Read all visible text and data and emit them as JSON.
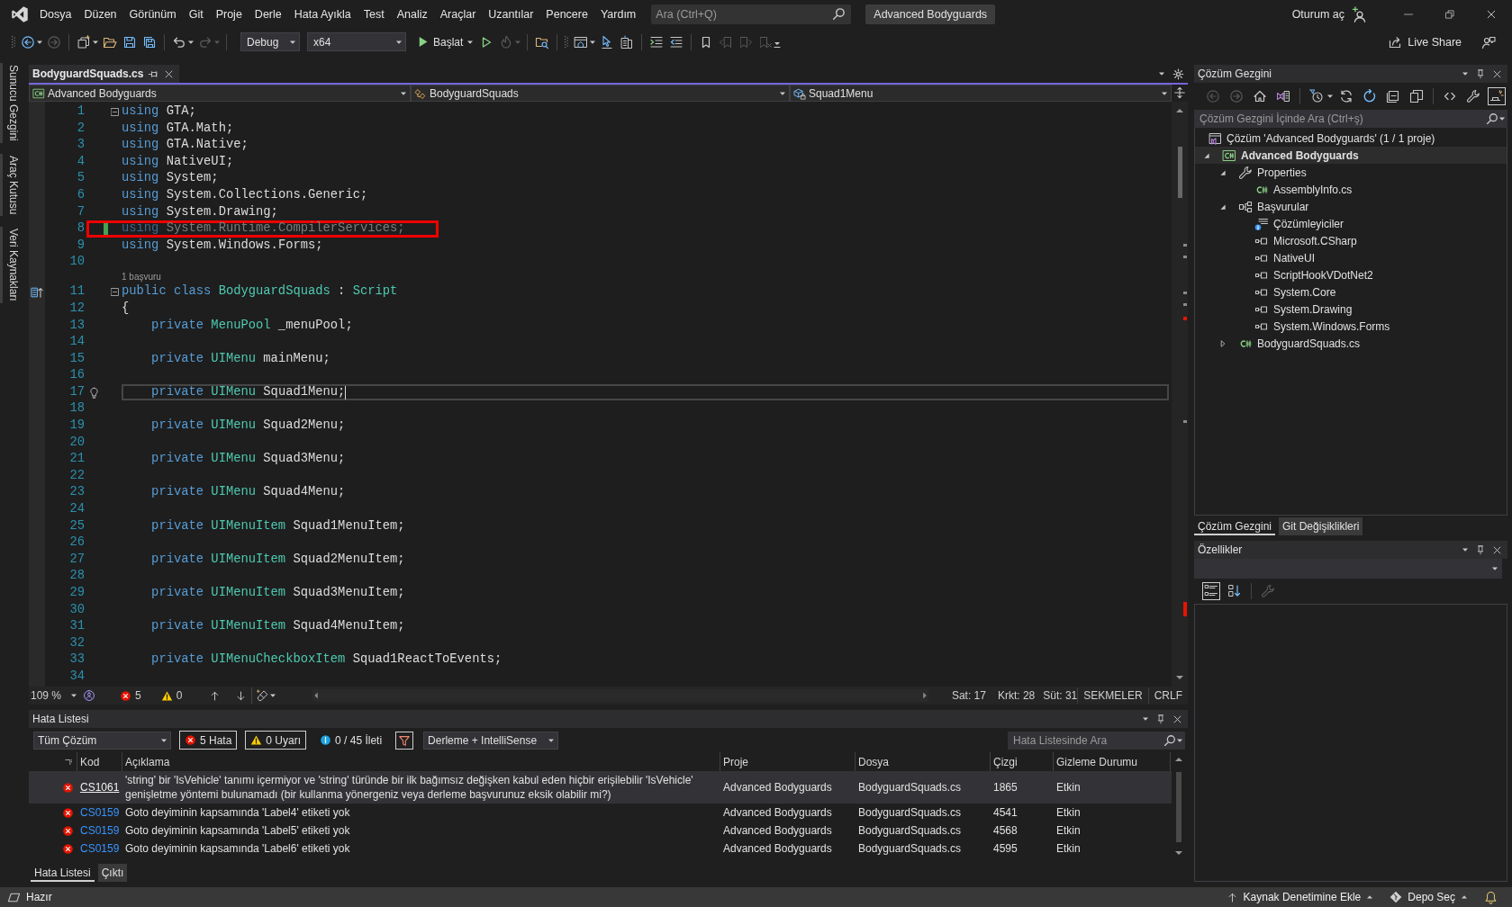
{
  "title_bar": {
    "menu": [
      "Dosya",
      "Düzen",
      "Görünüm",
      "Git",
      "Proje",
      "Derle",
      "Hata Ayıkla",
      "Test",
      "Analiz",
      "Araçlar",
      "Uzantılar",
      "Pencere",
      "Yardım"
    ],
    "search": {
      "placeholder": "Ara (Ctrl+Q)"
    },
    "solution_name": "Advanced Bodyguards",
    "sign_in": "Oturum aç"
  },
  "toolbar": {
    "history": [
      {
        "disabled": false
      },
      {
        "disabled": true
      }
    ],
    "file": [
      {
        "disabled": false
      },
      {
        "disabled": false
      },
      {
        "disabled": false
      },
      {
        "disabled": false
      }
    ],
    "edit": [
      {
        "disabled": false
      },
      {
        "disabled": true
      }
    ],
    "configuration": "Debug",
    "platform": "x64",
    "start": "Başlat",
    "run": [
      {
        "disabled": false
      },
      {
        "disabled": true
      }
    ],
    "tools": [
      {
        "disabled": false
      },
      {
        "disabled": false
      },
      {
        "disabled": false
      },
      {
        "disabled": false
      },
      {
        "disabled": false
      },
      {
        "disabled": false
      },
      {
        "disabled": false
      },
      {
        "disabled": true
      },
      {
        "disabled": true
      },
      {
        "disabled": true
      }
    ],
    "live_share": "Live Share"
  },
  "side_tabs": [
    "Sunucu Gezgini",
    "Araç Kutusu",
    "Veri Kaynakları"
  ],
  "editor": {
    "tabs": [
      {
        "label": "BodyguardSquads.cs",
        "selected": true
      }
    ],
    "navigation": {
      "project": "Advanced Bodyguards",
      "type": "BodyguardSquads",
      "member": "Squad1Menu"
    },
    "lines": [
      {
        "number": "1",
        "tokens": [
          {
            "text": "using",
            "kind": "keyword"
          },
          {
            "text": " GTA;",
            "kind": "plain"
          }
        ],
        "fold": {
          "expanded": true
        },
        "changed": false,
        "faded": false,
        "current": false,
        "annotated": false,
        "quick_actions": false,
        "inherits": false
      },
      {
        "number": "2",
        "tokens": [
          {
            "text": "using",
            "kind": "keyword"
          },
          {
            "text": " GTA.Math;",
            "kind": "plain"
          }
        ],
        "changed": false,
        "faded": false,
        "current": false,
        "annotated": false,
        "quick_actions": false,
        "inherits": false
      },
      {
        "number": "3",
        "tokens": [
          {
            "text": "using",
            "kind": "keyword"
          },
          {
            "text": " GTA.Native;",
            "kind": "plain"
          }
        ],
        "changed": false,
        "faded": false,
        "current": false,
        "annotated": false,
        "quick_actions": false,
        "inherits": false
      },
      {
        "number": "4",
        "tokens": [
          {
            "text": "using",
            "kind": "keyword"
          },
          {
            "text": " NativeUI;",
            "kind": "plain"
          }
        ],
        "changed": false,
        "faded": false,
        "current": false,
        "annotated": false,
        "quick_actions": false,
        "inherits": false
      },
      {
        "number": "5",
        "tokens": [
          {
            "text": "using",
            "kind": "keyword"
          },
          {
            "text": " System;",
            "kind": "plain"
          }
        ],
        "changed": false,
        "faded": false,
        "current": false,
        "annotated": false,
        "quick_actions": false,
        "inherits": false
      },
      {
        "number": "6",
        "tokens": [
          {
            "text": "using",
            "kind": "keyword"
          },
          {
            "text": " System.Collections.Generic;",
            "kind": "plain"
          }
        ],
        "changed": false,
        "faded": false,
        "current": false,
        "annotated": false,
        "quick_actions": false,
        "inherits": false
      },
      {
        "number": "7",
        "tokens": [
          {
            "text": "using",
            "kind": "keyword"
          },
          {
            "text": " System.Drawing;",
            "kind": "plain"
          }
        ],
        "changed": false,
        "faded": false,
        "current": false,
        "annotated": false,
        "quick_actions": false,
        "inherits": false
      },
      {
        "number": "8",
        "tokens": [
          {
            "text": "using",
            "kind": "keyword"
          },
          {
            "text": " System.Runtime.CompilerServices;",
            "kind": "plain"
          }
        ],
        "changed": true,
        "faded": true,
        "current": false,
        "annotated": true,
        "quick_actions": false,
        "inherits": false
      },
      {
        "number": "9",
        "tokens": [
          {
            "text": "using",
            "kind": "keyword"
          },
          {
            "text": " System.Windows.Forms;",
            "kind": "plain"
          }
        ],
        "changed": false,
        "faded": false,
        "current": false,
        "annotated": false,
        "quick_actions": false,
        "inherits": false
      },
      {
        "number": "10",
        "changed": false,
        "current": false,
        "annotated": false,
        "quick_actions": false,
        "inherits": false
      },
      {
        "number": "11",
        "codelens": "1 başvuru",
        "tokens": [
          {
            "text": "public class",
            "kind": "keyword"
          },
          {
            "text": " BodyguardSquads",
            "kind": "type"
          },
          {
            "text": " : ",
            "kind": "plain"
          },
          {
            "text": "Script",
            "kind": "type"
          }
        ],
        "fold": {
          "expanded": true
        },
        "changed": false,
        "faded": false,
        "current": false,
        "annotated": false,
        "quick_actions": false,
        "inherits": true
      },
      {
        "number": "12",
        "tokens": [
          {
            "text": "{",
            "kind": "plain"
          }
        ],
        "changed": false,
        "faded": false,
        "current": false,
        "annotated": false,
        "quick_actions": false,
        "inherits": false
      },
      {
        "number": "13",
        "tokens": [
          {
            "text": "    private",
            "kind": "keyword"
          },
          {
            "text": " MenuPool",
            "kind": "type"
          },
          {
            "text": " _menuPool;",
            "kind": "plain"
          }
        ],
        "changed": false,
        "faded": false,
        "current": false,
        "annotated": false,
        "quick_actions": false,
        "inherits": false
      },
      {
        "number": "14",
        "changed": false,
        "current": false,
        "annotated": false,
        "quick_actions": false,
        "inherits": false
      },
      {
        "number": "15",
        "tokens": [
          {
            "text": "    private",
            "kind": "keyword"
          },
          {
            "text": " UIMenu",
            "kind": "type"
          },
          {
            "text": " mainMenu;",
            "kind": "plain"
          }
        ],
        "changed": false,
        "faded": false,
        "current": false,
        "annotated": false,
        "quick_actions": false,
        "inherits": false
      },
      {
        "number": "16",
        "changed": false,
        "current": false,
        "annotated": false,
        "quick_actions": false,
        "inherits": false
      },
      {
        "number": "17",
        "tokens": [
          {
            "text": "    private",
            "kind": "keyword"
          },
          {
            "text": " UIMenu",
            "kind": "type"
          },
          {
            "text": " Squad1Menu;",
            "kind": "plain"
          }
        ],
        "changed": false,
        "faded": false,
        "current": true,
        "annotated": false,
        "quick_actions": true,
        "inherits": false
      },
      {
        "number": "18",
        "changed": false,
        "current": false,
        "annotated": false,
        "quick_actions": false,
        "inherits": false
      },
      {
        "number": "19",
        "tokens": [
          {
            "text": "    private",
            "kind": "keyword"
          },
          {
            "text": " UIMenu",
            "kind": "type"
          },
          {
            "text": " Squad2Menu;",
            "kind": "plain"
          }
        ],
        "changed": false,
        "faded": false,
        "current": false,
        "annotated": false,
        "quick_actions": false,
        "inherits": false
      },
      {
        "number": "20",
        "changed": false,
        "current": false,
        "annotated": false,
        "quick_actions": false,
        "inherits": false
      },
      {
        "number": "21",
        "tokens": [
          {
            "text": "    private",
            "kind": "keyword"
          },
          {
            "text": " UIMenu",
            "kind": "type"
          },
          {
            "text": " Squad3Menu;",
            "kind": "plain"
          }
        ],
        "changed": false,
        "faded": false,
        "current": false,
        "annotated": false,
        "quick_actions": false,
        "inherits": false
      },
      {
        "number": "22",
        "changed": false,
        "current": false,
        "annotated": false,
        "quick_actions": false,
        "inherits": false
      },
      {
        "number": "23",
        "tokens": [
          {
            "text": "    private",
            "kind": "keyword"
          },
          {
            "text": " UIMenu",
            "kind": "type"
          },
          {
            "text": " Squad4Menu;",
            "kind": "plain"
          }
        ],
        "changed": false,
        "faded": false,
        "current": false,
        "annotated": false,
        "quick_actions": false,
        "inherits": false
      },
      {
        "number": "24",
        "changed": false,
        "current": false,
        "annotated": false,
        "quick_actions": false,
        "inherits": false
      },
      {
        "number": "25",
        "tokens": [
          {
            "text": "    private",
            "kind": "keyword"
          },
          {
            "text": " UIMenuItem",
            "kind": "type"
          },
          {
            "text": " Squad1MenuItem;",
            "kind": "plain"
          }
        ],
        "changed": false,
        "faded": false,
        "current": false,
        "annotated": false,
        "quick_actions": false,
        "inherits": false
      },
      {
        "number": "26",
        "changed": false,
        "current": false,
        "annotated": false,
        "quick_actions": false,
        "inherits": false
      },
      {
        "number": "27",
        "tokens": [
          {
            "text": "    private",
            "kind": "keyword"
          },
          {
            "text": " UIMenuItem",
            "kind": "type"
          },
          {
            "text": " Squad2MenuItem;",
            "kind": "plain"
          }
        ],
        "changed": false,
        "faded": false,
        "current": false,
        "annotated": false,
        "quick_actions": false,
        "inherits": false
      },
      {
        "number": "28",
        "changed": false,
        "current": false,
        "annotated": false,
        "quick_actions": false,
        "inherits": false
      },
      {
        "number": "29",
        "tokens": [
          {
            "text": "    private",
            "kind": "keyword"
          },
          {
            "text": " UIMenuItem",
            "kind": "type"
          },
          {
            "text": " Squad3MenuItem;",
            "kind": "plain"
          }
        ],
        "changed": false,
        "faded": false,
        "current": false,
        "annotated": false,
        "quick_actions": false,
        "inherits": false
      },
      {
        "number": "30",
        "changed": false,
        "current": false,
        "annotated": false,
        "quick_actions": false,
        "inherits": false
      },
      {
        "number": "31",
        "tokens": [
          {
            "text": "    private",
            "kind": "keyword"
          },
          {
            "text": " UIMenuItem",
            "kind": "type"
          },
          {
            "text": " Squad4MenuItem;",
            "kind": "plain"
          }
        ],
        "changed": false,
        "faded": false,
        "current": false,
        "annotated": false,
        "quick_actions": false,
        "inherits": false
      },
      {
        "number": "32",
        "changed": false,
        "current": false,
        "annotated": false,
        "quick_actions": false,
        "inherits": false
      },
      {
        "number": "33",
        "tokens": [
          {
            "text": "    private",
            "kind": "keyword"
          },
          {
            "text": " UIMenuCheckboxItem",
            "kind": "type"
          },
          {
            "text": " Squad1ReactToEvents;",
            "kind": "plain"
          }
        ],
        "changed": false,
        "faded": false,
        "current": false,
        "annotated": false,
        "quick_actions": false,
        "inherits": false
      },
      {
        "number": "34",
        "changed": false,
        "current": false,
        "annotated": false,
        "quick_actions": false,
        "inherits": false
      }
    ],
    "status": {
      "zoom": "109 %",
      "errors": "5",
      "warnings": "0",
      "line": "Sat: 17",
      "char": "Krkt: 28",
      "column": "Süt: 31",
      "indentation": "SEKMELER",
      "line_ending": "CRLF"
    }
  },
  "error_list": {
    "title": "Hata Listesi",
    "scope": "Tüm Çözüm",
    "filters": [
      {
        "label": "5 Hata",
        "kind": "error",
        "selected": true
      },
      {
        "label": "0 Uyarı",
        "kind": "warning",
        "selected": true
      },
      {
        "label": "0 / 45 İleti",
        "kind": "message",
        "selected": false
      }
    ],
    "filter": {
      "on": true
    },
    "source": "Derleme + IntelliSense",
    "search": {
      "placeholder": "Hata Listesinde Ara"
    },
    "columns": [
      "Kod",
      "Açıklama",
      "Proje",
      "Dosya",
      "Çizgi",
      "Gizleme Durumu"
    ],
    "rows": [
      {
        "kind": "error",
        "code": "CS1061",
        "description": "'string' bir 'IsVehicle' tanımı içermiyor ve 'string' türünde bir ilk bağımsız değişken kabul eden hiçbir erişilebilir 'IsVehicle' genişletme yöntemi bulunamadı (bir kullanma yönergeniz veya derleme başvurunuz eksik olabilir mi?)",
        "project": "Advanced Bodyguards",
        "file": "BodyguardSquads.cs",
        "line": "1865",
        "suppression": "Etkin",
        "selected": true
      },
      {
        "kind": "error",
        "code": "CS0159",
        "description": "Goto deyiminin kapsamında 'Label4' etiketi yok",
        "project": "Advanced Bodyguards",
        "file": "BodyguardSquads.cs",
        "line": "4541",
        "suppression": "Etkin",
        "selected": false
      },
      {
        "kind": "error",
        "code": "CS0159",
        "description": "Goto deyiminin kapsamında 'Label5' etiketi yok",
        "project": "Advanced Bodyguards",
        "file": "BodyguardSquads.cs",
        "line": "4568",
        "suppression": "Etkin",
        "selected": false
      },
      {
        "kind": "error",
        "code": "CS0159",
        "description": "Goto deyiminin kapsamında 'Label6' etiketi yok",
        "project": "Advanced Bodyguards",
        "file": "BodyguardSquads.cs",
        "line": "4595",
        "suppression": "Etkin",
        "selected": false
      }
    ],
    "tabs": [
      {
        "label": "Hata Listesi",
        "selected": true
      },
      {
        "label": "Çıktı",
        "selected": false
      }
    ]
  },
  "solution_explorer": {
    "title": "Çözüm Gezgini",
    "toolbar": [
      {
        "disabled": true,
        "on": false
      },
      {
        "disabled": true,
        "on": false
      },
      {
        "disabled": false,
        "on": false
      },
      {
        "disabled": false,
        "on": false
      },
      {
        "disabled": false,
        "on": false
      },
      {
        "disabled": false,
        "on": false
      },
      {
        "disabled": false,
        "on": false
      },
      {
        "disabled": false,
        "on": false
      },
      {
        "disabled": false,
        "on": false
      },
      {
        "disabled": false,
        "on": false
      },
      {
        "disabled": false,
        "on": false
      },
      {
        "disabled": false,
        "on": true
      }
    ],
    "search": {
      "placeholder": "Çözüm Gezgini İçinde Ara (Ctrl+ş)"
    },
    "tree": [
      {
        "label": "Çözüm 'Advanced Bodyguards' (1 / 1 proje)",
        "kind": "solution",
        "selected": false,
        "children": [
          {
            "label": "Advanced Bodyguards",
            "kind": "project",
            "selected": true,
            "expanded": true,
            "children": [
              {
                "label": "Properties",
                "kind": "properties",
                "selected": false,
                "expanded": true,
                "children": [
                  {
                    "label": "AssemblyInfo.cs",
                    "kind": "csharp",
                    "selected": false
                  }
                ]
              },
              {
                "label": "Başvurular",
                "kind": "references",
                "selected": false,
                "expanded": true,
                "children": [
                  {
                    "label": "Çözümleyiciler",
                    "kind": "analyzers",
                    "selected": false
                  },
                  {
                    "label": "Microsoft.CSharp",
                    "kind": "reference",
                    "selected": false
                  },
                  {
                    "label": "NativeUI",
                    "kind": "reference",
                    "selected": false
                  },
                  {
                    "label": "ScriptHookVDotNet2",
                    "kind": "reference",
                    "selected": false
                  },
                  {
                    "label": "System.Core",
                    "kind": "reference",
                    "selected": false
                  },
                  {
                    "label": "System.Drawing",
                    "kind": "reference",
                    "selected": false
                  },
                  {
                    "label": "System.Windows.Forms",
                    "kind": "reference",
                    "selected": false
                  }
                ]
              },
              {
                "label": "BodyguardSquads.cs",
                "kind": "csharp",
                "selected": false,
                "expanded": false
              }
            ]
          }
        ]
      }
    ],
    "tabs": [
      {
        "label": "Çözüm Gezgini",
        "selected": true
      },
      {
        "label": "Git Değişiklikleri",
        "selected": false
      }
    ]
  },
  "properties": {
    "title": "Özellikler",
    "toolbar": [
      {
        "disabled": false,
        "on": true
      },
      {
        "disabled": false,
        "on": false
      },
      {
        "disabled": true,
        "on": false
      }
    ]
  },
  "status_bar": {
    "text": "Hazır",
    "source_control": "Kaynak Denetimine Ekle",
    "repository": "Depo Seç"
  }
}
